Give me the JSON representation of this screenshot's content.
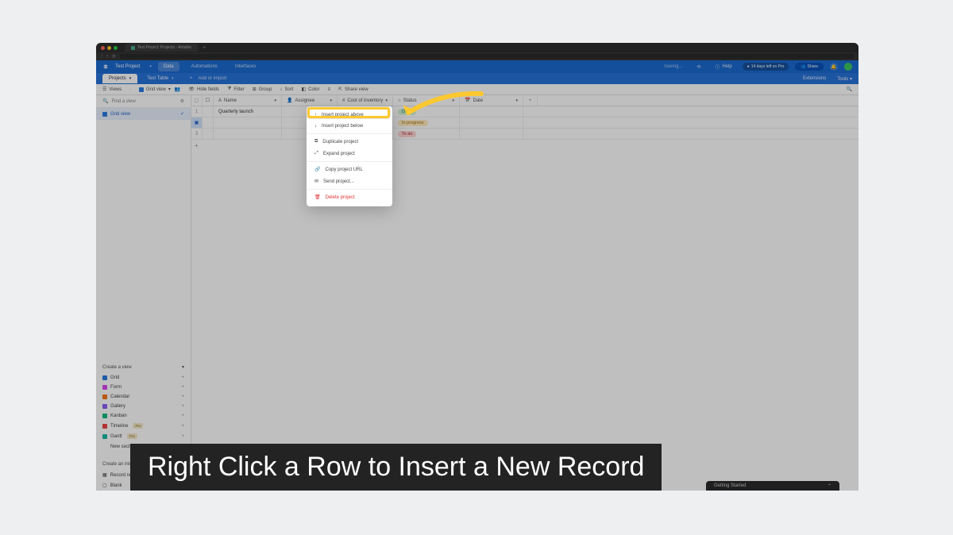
{
  "browser": {
    "tab_title": "Test Project: Projects - Airtable"
  },
  "header": {
    "title": "Test Project",
    "tabs": {
      "data": "Data",
      "automations": "Automations",
      "interfaces": "Interfaces"
    },
    "saving": "Saving...",
    "help": "Help",
    "trial": "14 days left on Pro",
    "share": "Share"
  },
  "tabrow": {
    "projects": "Projects",
    "test_table": "Test Table",
    "add": "Add or import"
  },
  "toolbar": {
    "views": "Views",
    "grid_view": "Grid view",
    "hide": "Hide fields",
    "filter": "Filter",
    "group": "Group",
    "sort": "Sort",
    "color": "Color",
    "share_view": "Share view",
    "extensions": "Extensions",
    "tools": "Tools"
  },
  "sidebar": {
    "find": "Find a view",
    "grid_view": "Grid view",
    "create_view": "Create a view",
    "items": {
      "grid": "Grid",
      "form": "Form",
      "calendar": "Calendar",
      "gallery": "Gallery",
      "kanban": "Kanban",
      "timeline": "Timeline",
      "gantt": "Gantt",
      "new_section": "New section"
    },
    "pro": "Pro",
    "create_interface": "Create an interface",
    "interface_items": {
      "record": "Record review",
      "blank": "Blank"
    }
  },
  "columns": {
    "name": "Name",
    "assignee": "Assignee",
    "cost": "Cost of inventory",
    "status": "Status",
    "date": "Date"
  },
  "rows": [
    {
      "num": "1",
      "name": "Quarterly launch",
      "status": "Done",
      "status_class": "s-done"
    },
    {
      "num": "2",
      "name": "",
      "status": "In progress",
      "status_class": "s-prog"
    },
    {
      "num": "3",
      "name": "",
      "status": "To do",
      "status_class": "s-todo"
    }
  ],
  "context_menu": {
    "insert_above": "Insert project above",
    "insert_below": "Insert project below",
    "duplicate": "Duplicate project",
    "expand": "Expand project",
    "copy_url": "Copy project URL",
    "send": "Send project...",
    "delete": "Delete project"
  },
  "getting_started": "Getting Started",
  "caption": "Right Click a Row to Insert a New Record"
}
